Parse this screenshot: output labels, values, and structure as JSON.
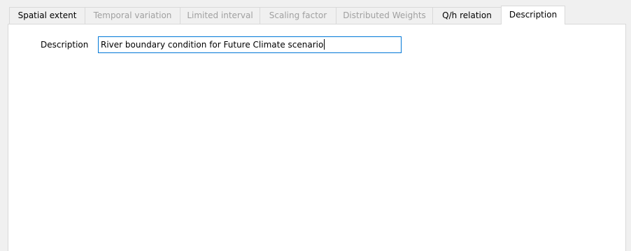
{
  "tabs": [
    {
      "label": "Spatial extent",
      "state": "enabled"
    },
    {
      "label": "Temporal variation",
      "state": "disabled"
    },
    {
      "label": "Limited interval",
      "state": "disabled"
    },
    {
      "label": "Scaling factor",
      "state": "disabled"
    },
    {
      "label": "Distributed Weights",
      "state": "disabled"
    },
    {
      "label": "Q/h relation",
      "state": "enabled"
    },
    {
      "label": "Description",
      "state": "active"
    }
  ],
  "description_panel": {
    "label": "Description",
    "value": "River boundary condition for Future Climate scenario"
  },
  "colors": {
    "focus_border": "#0078d7",
    "disabled_text": "#a0a0a0",
    "tab_border": "#d9d9d9"
  }
}
